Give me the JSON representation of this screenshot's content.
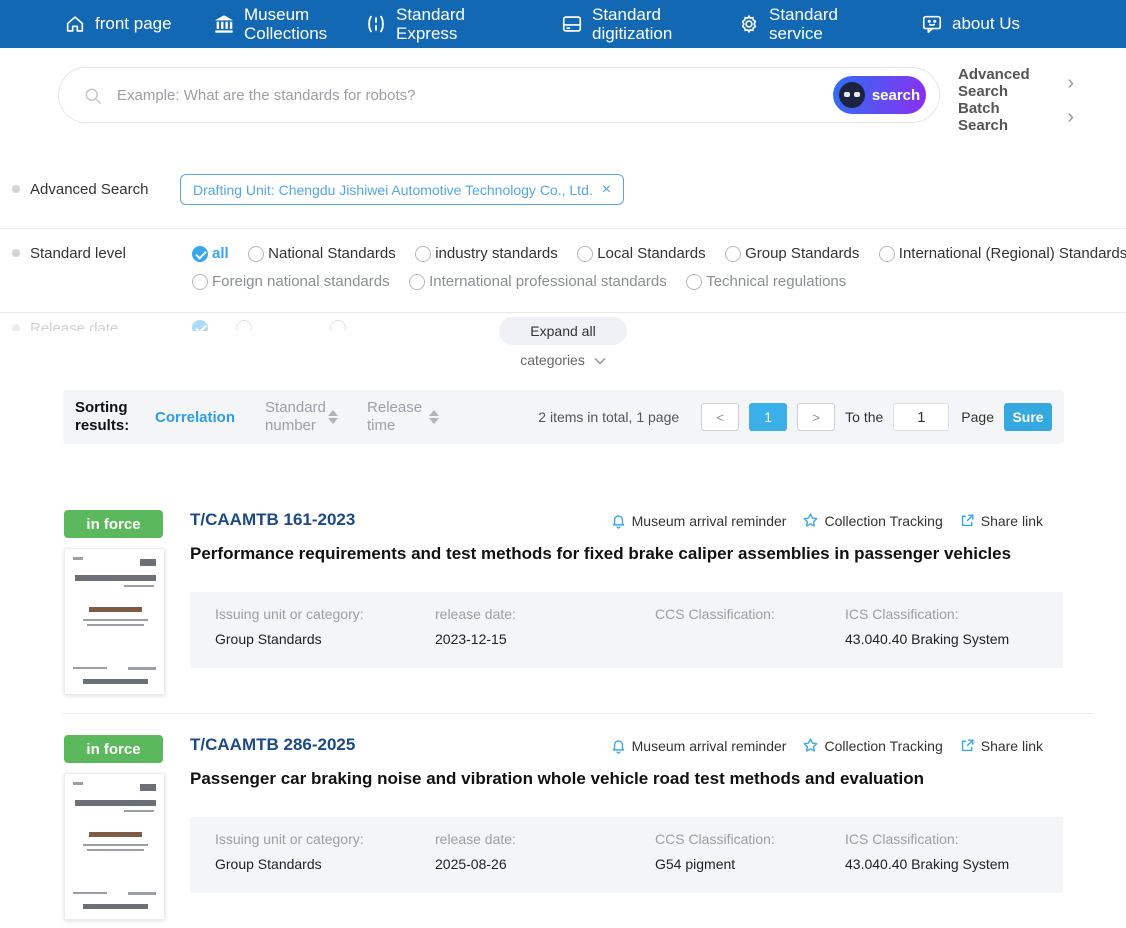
{
  "icons": {
    "close": "×",
    "chevron_right": "›"
  },
  "colors": {
    "nav_bg": "#1268b3",
    "accent_blue": "#3aa8e8",
    "tag_blue": "#54a6e8",
    "badge_green": "#5cb85c",
    "number_navy": "#1b4a85",
    "correlation_blue": "#2e9fe0",
    "pagination_active": "#3bb0e8",
    "search_gradient": [
      "#2f6ef5",
      "#8a2ff0"
    ]
  },
  "nav": {
    "items": [
      {
        "label": "front page",
        "icon": "home-icon"
      },
      {
        "label": "Museum Collections",
        "icon": "museum-icon"
      },
      {
        "label": "Standard Express",
        "icon": "express-icon"
      },
      {
        "label": "Standard digitization",
        "icon": "digitization-icon"
      },
      {
        "label": "Standard service",
        "icon": "service-icon"
      },
      {
        "label": "about Us",
        "icon": "about-icon"
      }
    ]
  },
  "search": {
    "placeholder": "Example: What are the standards for robots?",
    "button_label": "search",
    "advanced_link": "Advanced Search",
    "batch_link": "Batch Search"
  },
  "filters": {
    "advanced_row_label": "Advanced Search",
    "tag": "Drafting Unit: Chengdu Jishiwei Automotive Technology Co., Ltd.",
    "standard_level_label": "Standard level",
    "level_row1": [
      "all",
      "National Standards",
      "industry standards",
      "Local Standards",
      "Group Standards",
      "International (Regional) Standards"
    ],
    "level_row2": [
      "Foreign national standards",
      "International professional standards",
      "Technical regulations"
    ],
    "selected_level": "all",
    "clipped_row_label": "Release date",
    "expand_all_label": "Expand all",
    "categories_label": "categories"
  },
  "sorting": {
    "label": "Sorting results:",
    "active_option": "Correlation",
    "option_number": "Standard number",
    "option_time": "Release time",
    "summary": "2 items in total, 1 page",
    "prev": "<",
    "current_page": "1",
    "next": ">",
    "goto_prefix": "To the",
    "goto_value": "1",
    "goto_suffix": "Page",
    "confirm": "Sure"
  },
  "result_actions": [
    "Museum arrival reminder",
    "Collection Tracking",
    "Share link"
  ],
  "results": [
    {
      "status": "in force",
      "number": "T/CAAMTB 161-2023",
      "title": "Performance requirements and test methods for fixed brake caliper assemblies in passenger vehicles",
      "fields": [
        {
          "label": "Issuing unit or category:",
          "value": "Group Standards"
        },
        {
          "label": "release date:",
          "value": "2023-12-15"
        },
        {
          "label": "CCS Classification:",
          "value": ""
        },
        {
          "label": "ICS Classification:",
          "value": "43.040.40 Braking System"
        }
      ]
    },
    {
      "status": "in force",
      "number": "T/CAAMTB 286-2025",
      "title": "Passenger car braking noise and vibration whole vehicle road test methods and evaluation",
      "fields": [
        {
          "label": "Issuing unit or category:",
          "value": "Group Standards"
        },
        {
          "label": "release date:",
          "value": "2025-08-26"
        },
        {
          "label": "CCS Classification:",
          "value": "G54 pigment"
        },
        {
          "label": "ICS Classification:",
          "value": "43.040.40 Braking System"
        }
      ]
    }
  ]
}
